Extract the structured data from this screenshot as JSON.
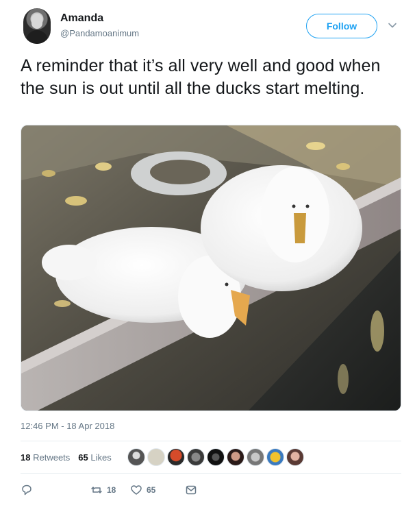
{
  "user": {
    "name": "Amanda",
    "handle": "@Pandamoanimum"
  },
  "header": {
    "follow_label": "Follow",
    "menu_icon": "chevron-down-icon"
  },
  "tweet": {
    "text": "A reminder that it’s all very well and good when the sun is out until all the ducks start melting.",
    "timestamp": "12:46 PM - 18 Apr 2018"
  },
  "stats": {
    "retweets_count": "18",
    "retweets_label": "Retweets",
    "likes_count": "65",
    "likes_label": "Likes"
  },
  "likers": [
    "avatar-1",
    "avatar-2",
    "avatar-3",
    "avatar-4",
    "avatar-5",
    "avatar-6",
    "avatar-7",
    "avatar-8",
    "avatar-9"
  ],
  "actions": {
    "reply_icon": "reply-icon",
    "retweet_icon": "retweet-icon",
    "retweet_count": "18",
    "like_icon": "heart-icon",
    "like_count": "65",
    "dm_icon": "envelope-icon"
  },
  "colors": {
    "accent": "#1da1f2",
    "secondary_text": "#657786",
    "primary_text": "#14171a"
  }
}
